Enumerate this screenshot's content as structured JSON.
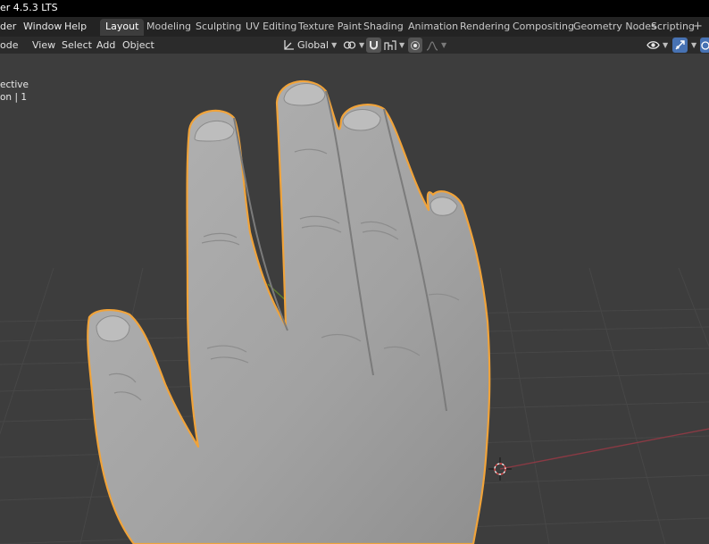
{
  "window": {
    "title": "er 4.5.3 LTS"
  },
  "menus": [
    "der",
    "Window",
    "Help"
  ],
  "workspaces": [
    "Layout",
    "Modeling",
    "Sculpting",
    "UV Editing",
    "Texture Paint",
    "Shading",
    "Animation",
    "Rendering",
    "Compositing",
    "Geometry Nodes",
    "Scripting"
  ],
  "active_workspace": "Layout",
  "workspace_add": "+",
  "viewport_header": {
    "mode": "ode",
    "menus": [
      "View",
      "Select",
      "Add",
      "Object"
    ],
    "transform_orientation": "Global"
  },
  "viewport_overlay": {
    "view_name": "ective",
    "collection_label": "on",
    "collection_count": "1"
  },
  "colors": {
    "viewport_bg": "#3d3d3d",
    "grid": "#484848",
    "axis_x": "#8a3a44",
    "axis_y": "#5f7f2c",
    "selection_outline": "#f0a33a",
    "mesh": "#a7a7a7",
    "active_button": "#4772b3"
  }
}
